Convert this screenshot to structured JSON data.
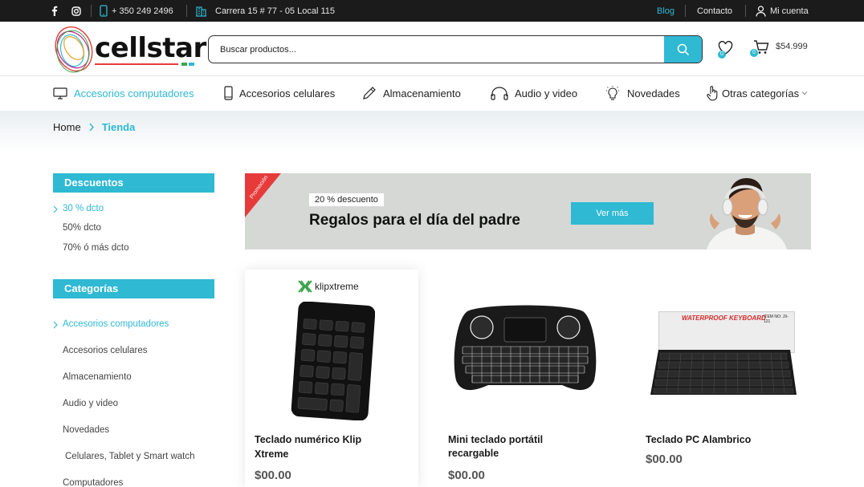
{
  "topbar": {
    "phone": "+ 350 249 2496",
    "address": "Carrera 15 # 77 - 05 Local 115",
    "blog": "Blog",
    "contact": "Contacto",
    "account": "Mi cuenta"
  },
  "header": {
    "logo_text": "cellstar",
    "search_placeholder": "Buscar productos...",
    "wishlist_count": "0",
    "cart_count": "0",
    "cart_total": "$54.999"
  },
  "nav": {
    "items": [
      {
        "label": "Accesorios computadores",
        "icon": "monitor-icon"
      },
      {
        "label": "Accesorios celulares",
        "icon": "phone-icon"
      },
      {
        "label": "Almacenamiento",
        "icon": "pen-icon"
      },
      {
        "label": "Audio y video",
        "icon": "headphones-icon"
      },
      {
        "label": "Novedades",
        "icon": "lightbulb-icon"
      },
      {
        "label": "Otras categorías",
        "icon": "hand-pointer-icon"
      }
    ]
  },
  "breadcrumb": {
    "home": "Home",
    "current": "Tienda"
  },
  "sidebar": {
    "discounts_title": "Descuentos",
    "discounts": [
      "30 % dcto",
      "50% dcto",
      "70% ó más dcto"
    ],
    "categories_title": "Categorías",
    "categories": [
      "Accesorios computadores",
      "Accesorios celulares",
      "Almacenamiento",
      "Audio y video",
      "Novedades",
      "Celulares, Tablet y Smart watch",
      "Computadores"
    ]
  },
  "promo": {
    "ribbon": "Promoción",
    "tag": "20 % descuento",
    "title": "Regalos para el día del padre",
    "button": "Ver más"
  },
  "products": [
    {
      "brand": "klipxtreme",
      "name_line1": "Teclado numérico Klip",
      "name_line2": "Xtreme",
      "price": "$00.00"
    },
    {
      "name_line1": "Mini teclado portátil",
      "name_line2": "recargable",
      "price": "$00.00"
    },
    {
      "banner": "WATERPROOF KEYBOARD",
      "item_no": "ITEM NO: JX-121",
      "name_line1": "Teclado PC Alambrico",
      "name_line2": "",
      "price": "$00.00"
    }
  ],
  "colors": {
    "accent": "#2fb9d3",
    "topbar": "#1b1b1b",
    "ribbon": "#e73b3b"
  }
}
